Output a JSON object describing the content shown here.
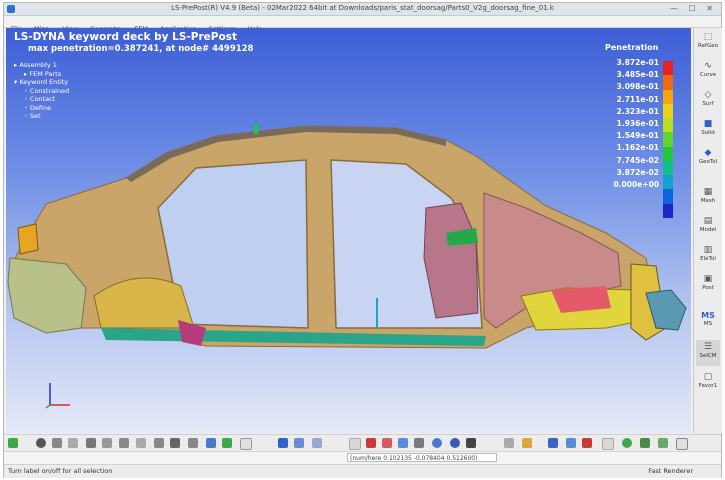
{
  "window": {
    "title": "LS-PrePost(R) V4.9 (Beta) - 02Mar2022 64bit at Downloads/paris_stat_doorsag/Parts0_V2g_doorsag_fine_01.k",
    "controls": "— ☐ ✕"
  },
  "menu": [
    "File",
    "Misc.",
    "View",
    "Geometry",
    "FEM",
    "Application",
    "Settings",
    "Help"
  ],
  "viewport": {
    "title": "LS-DYNA keyword deck by LS-PrePost",
    "subtitle": "max penetration=0.387241, at node# 4499128",
    "tree": {
      "assembly": "Assembly 1",
      "fem_parts": "FEM Parts",
      "keyword_entity": "Keyword Entity",
      "children": [
        "Constrained",
        "Contact",
        "Define",
        "Set"
      ]
    }
  },
  "legend": {
    "title": "Penetration",
    "values": [
      "3.872e-01",
      "3.485e-01",
      "3.098e-01",
      "2.711e-01",
      "2.323e-01",
      "1.936e-01",
      "1.549e-01",
      "1.162e-01",
      "7.745e-02",
      "3.872e-02",
      "0.000e+00"
    ],
    "colors": [
      "#e8231e",
      "#f06a10",
      "#f5a60f",
      "#e8d21b",
      "#b8e01e",
      "#5fd629",
      "#21c83e",
      "#16bd8a",
      "#11a4c8",
      "#0f63d8",
      "#1c25c8"
    ]
  },
  "right_toolbar": [
    {
      "label": "RefGeo",
      "icon": "refgeo-icon"
    },
    {
      "label": "Curve",
      "icon": "curve-icon"
    },
    {
      "label": "Surf",
      "icon": "surface-icon"
    },
    {
      "label": "Solid",
      "icon": "solid-icon"
    },
    {
      "label": "GeoTol",
      "icon": "geotol-icon"
    },
    {
      "label": "Mesh",
      "icon": "mesh-icon"
    },
    {
      "label": "Model",
      "icon": "model-icon"
    },
    {
      "label": "EleTol",
      "icon": "eletol-icon"
    },
    {
      "label": "Post",
      "icon": "post-icon"
    },
    {
      "label": "MS",
      "icon": "ms-icon"
    },
    {
      "label": "SelCM",
      "icon": "selcm-icon"
    },
    {
      "label": "Favor1",
      "icon": "favor-icon"
    }
  ],
  "command": {
    "coordinates": "(num/here 0.102135 -0.078404 0.512600)"
  },
  "status": {
    "left": "Turn label on/off for all selection",
    "right": "Fast Renderer"
  },
  "colors": {
    "body_tan": "#c9a56a",
    "body_pink": "#c98a8a",
    "bumper_green": "#b9c08a",
    "yellow_part": "#e0d63c",
    "teal_part": "#2aa58a"
  }
}
